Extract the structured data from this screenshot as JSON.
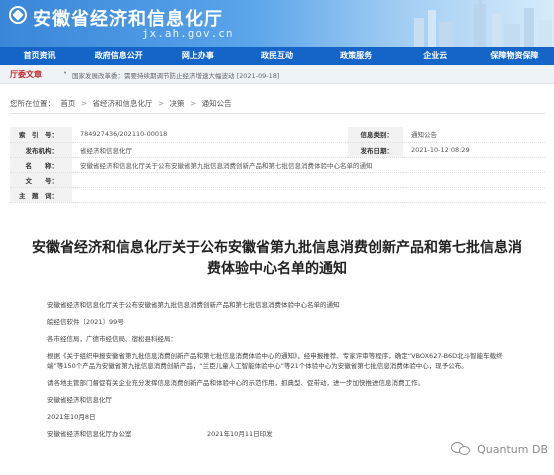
{
  "header": {
    "site_title": "安徽省经济和信息化厅",
    "domain": "jx.ah.gov.cn"
  },
  "nav": {
    "items": [
      "首页资讯",
      "政府信息公开",
      "网上办事",
      "政民互动",
      "政策服务",
      "企业云",
      "保障物资保障"
    ]
  },
  "ticker": {
    "label": "厅委文章",
    "text": "国家发展改革委：需要持续期调节防止经济增速大幅波动 [2021-09-18]"
  },
  "breadcrumb": {
    "prefix": "您所在位置：",
    "items": [
      "首页",
      "省经济和信息化厅",
      "决策",
      "通知公告"
    ],
    "separator": ">"
  },
  "meta": {
    "index_label": "索　引　号：",
    "index_value": "784927436/202110-00018",
    "category_label": "信息类别：",
    "category_value": "通知公告",
    "org_label": "发布机构：",
    "org_value": "省经济和信息化厅",
    "date_label": "发布日期：",
    "date_value": "2021-10-12 08:29",
    "title_label": "名　　称：",
    "title_value": "安徽省经济和信息化厅关于公布安徽省第九批信息消费创新产品和第七批信息消费体验中心名单的通知",
    "doc_label": "文　　号：",
    "doc_value": "",
    "theme_label": "主　题　词：",
    "theme_value": ""
  },
  "article": {
    "headline": "安徽省经济和信息化厅关于公布安徽省第九批信息消费创新产品和第七批信息消费体验中心名单的通知",
    "p1": "安徽省经济和信息化厅关于公布安徽省第九批信息消费创新产品和第七批信息消费体验中心名单的通知",
    "p2": "皖经信软件〔2021〕99号",
    "p3": "各市经信局，广德市经信局、宿松县科经局：",
    "p4": "根据《关于组织申报安徽省第九批信息消费创新产品和第七批信息消费体验中心的通知》，经申报推荐、专家评审等程序，确定“VBOX627-B6D北斗智能车载终端”等150个产品为安徽省第九批信息消费创新产品，“兰臣儿童人工智能体验中心”等21个体验中心为安徽省第七批信息消费体验中心，现予公布。",
    "p5": "请各地主管部门督促有关企业充分发挥信息消费创新产品和体验中心的示范作用，抓典型、促带动，进一步加快推进信息消费工作。",
    "p6": "安徽省经济和信息化厅",
    "p7": "2021年10月8日",
    "foot_left": "安徽省经济和信息化厅办公室",
    "foot_right": "2021年10月11日印发"
  },
  "watermark": {
    "text": "Quantum DB"
  },
  "colors": {
    "nav_bg": "#1565c9",
    "ticker_label": "#c4272e",
    "banner_start": "#3a86d8"
  }
}
